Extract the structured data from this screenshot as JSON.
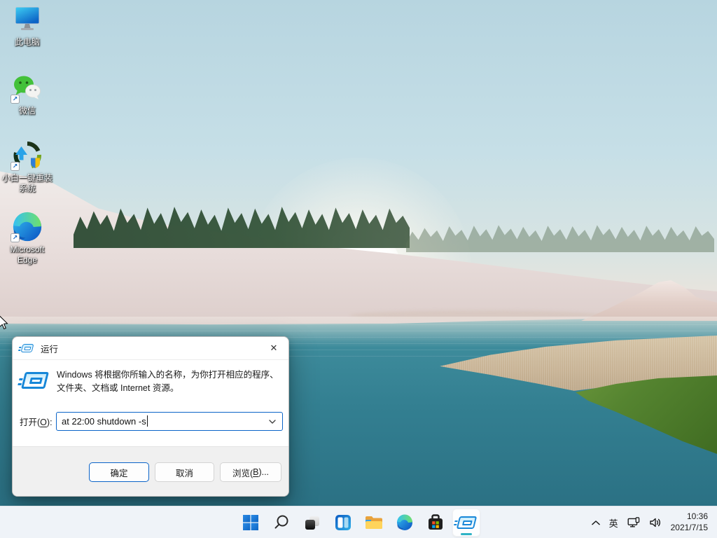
{
  "desktop": {
    "icons": [
      {
        "label": "此电脑",
        "shortcut": false
      },
      {
        "label": "微信",
        "shortcut": true
      },
      {
        "label": "小白一键重装系统",
        "shortcut": true
      },
      {
        "label": "Microsoft Edge",
        "shortcut": true
      }
    ],
    "shortcut_glyph": "↗"
  },
  "run_dialog": {
    "title": "运行",
    "close_glyph": "✕",
    "description": "Windows 将根据你所输入的名称，为你打开相应的程序、文件夹、文档或 Internet 资源。",
    "open_label": {
      "prefix": "打开(",
      "mnemonic": "O",
      "suffix": "):"
    },
    "input_value": "at 22:00 shutdown -s",
    "buttons": {
      "ok": "确定",
      "cancel": "取消",
      "browse": {
        "prefix": "浏览(",
        "mnemonic": "B",
        "suffix": ")..."
      }
    }
  },
  "taskbar": {
    "items": [
      "start",
      "search",
      "task-view",
      "widgets",
      "file-explorer",
      "edge",
      "store",
      "run"
    ],
    "active_item": "run",
    "tray": {
      "ime": "英",
      "time": "10:36",
      "date": "2021/7/15"
    }
  },
  "colors": {
    "accent": "#0b64c8",
    "run_icon_blue": "#1787d8",
    "active_indicator": "#2fb3c6",
    "taskbar_bg": "#eff3f8",
    "water_teal": "#337f91"
  }
}
